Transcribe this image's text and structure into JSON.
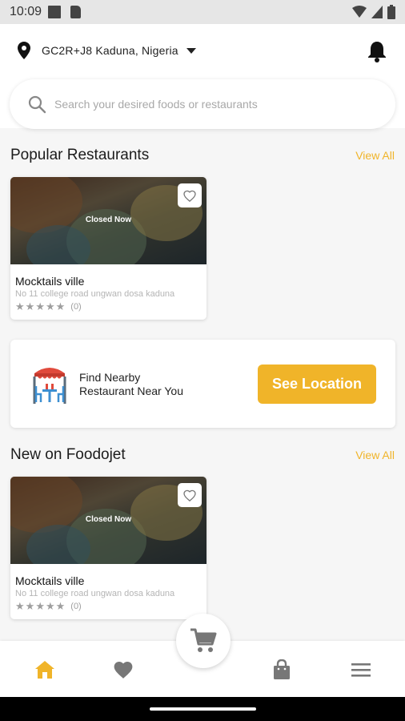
{
  "status_bar": {
    "time": "10:09"
  },
  "header": {
    "location": "GC2R+J8 Kaduna, Nigeria",
    "search_placeholder": "Search your desired foods or restaurants"
  },
  "popular": {
    "title": "Popular Restaurants",
    "view_all": "View All",
    "restaurants": [
      {
        "status": "Closed Now",
        "name": "Mocktails ville",
        "address": "No 11 college road ungwan dosa kaduna",
        "rating_count": "(0)",
        "stars": 0
      }
    ]
  },
  "nearby": {
    "line1": "Find Nearby",
    "line2": "Restaurant Near You",
    "button": "See Location"
  },
  "new_on": {
    "title": "New on Foodojet",
    "view_all": "View All",
    "restaurants": [
      {
        "status": "Closed Now",
        "name": "Mocktails ville",
        "address": "No 11 college road ungwan dosa kaduna",
        "rating_count": "(0)",
        "stars": 0
      }
    ]
  },
  "nav": {
    "items": [
      "home-icon",
      "heart-icon",
      "cart-icon",
      "shopping-bag-icon",
      "menu-icon"
    ],
    "active": "home-icon"
  },
  "colors": {
    "accent": "#f0b429",
    "inactive_icon": "#777777"
  }
}
